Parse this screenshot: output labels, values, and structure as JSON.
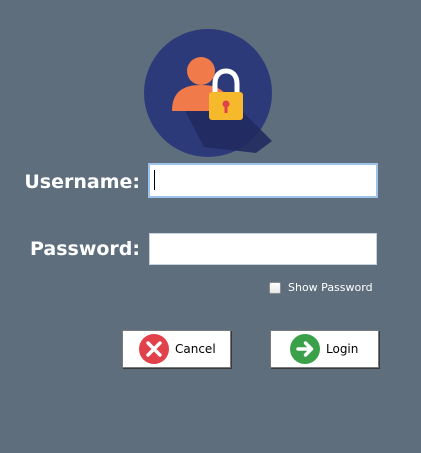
{
  "form": {
    "username_label": "Username:",
    "password_label": "Password:",
    "username_value": "",
    "password_value": "",
    "show_password_label": "Show Password",
    "show_password_checked": false
  },
  "buttons": {
    "cancel_label": "Cancel",
    "login_label": "Login"
  },
  "icons": {
    "logo": "user-lock-icon",
    "cancel": "cancel-x-icon",
    "login": "arrow-right-icon"
  },
  "colors": {
    "background": "#5e6e7d",
    "logo_circle": "#2d3a7a",
    "cancel_red": "#e0414a",
    "login_green": "#3aa04a",
    "lock_yellow": "#f6b92b",
    "user_orange": "#f07a4a"
  }
}
